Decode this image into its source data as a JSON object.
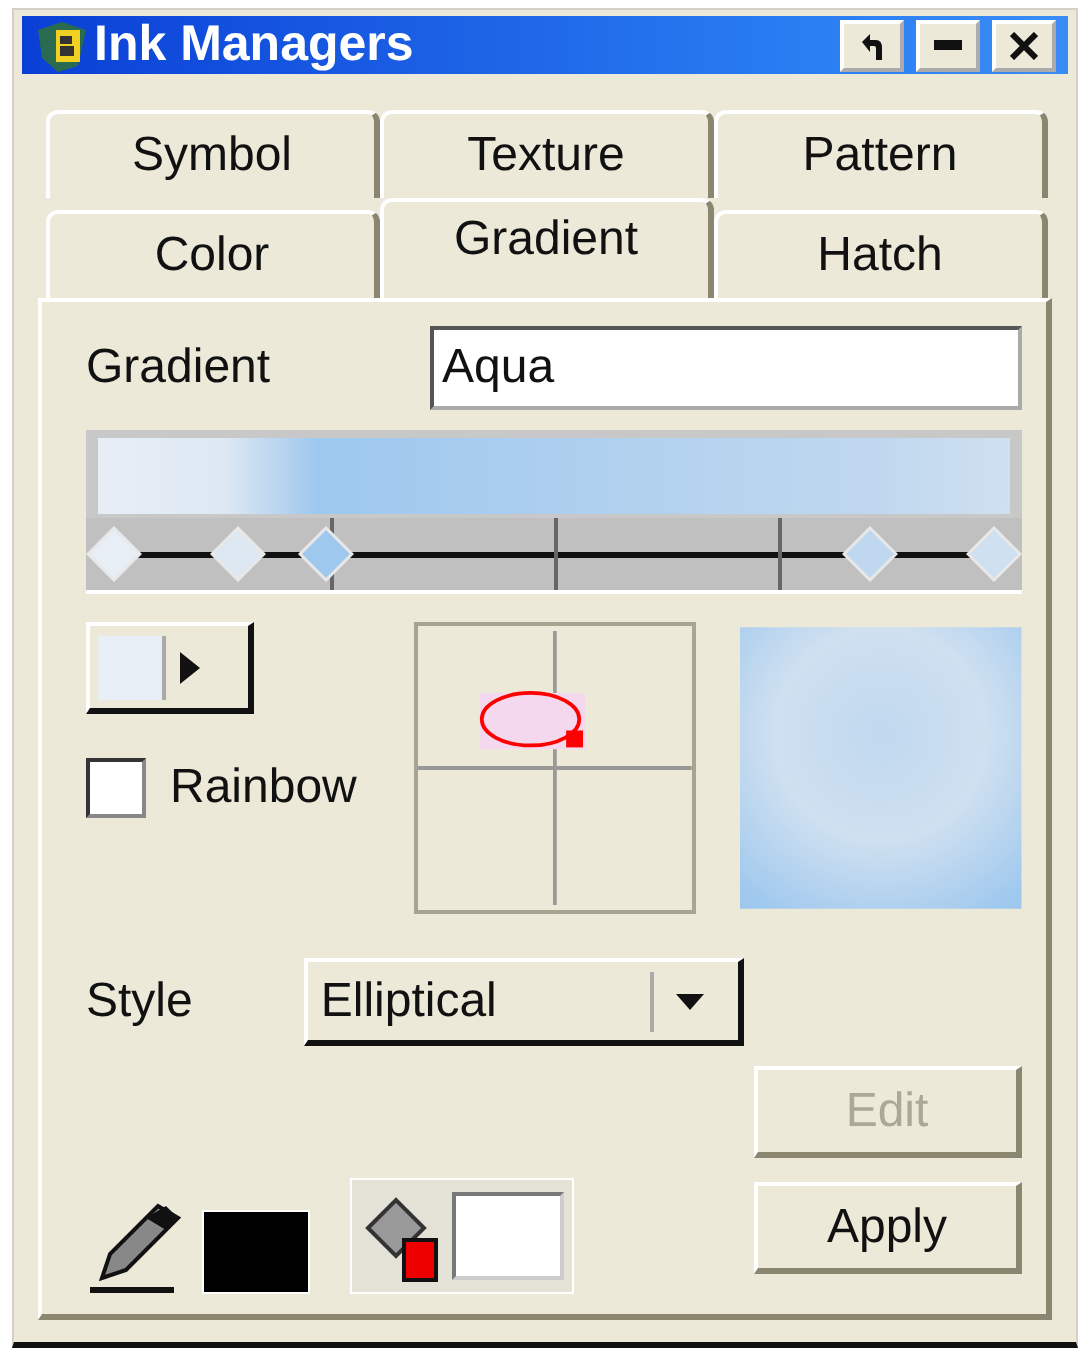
{
  "window": {
    "title": "Ink Managers"
  },
  "tab_rows": [
    {
      "tabs": [
        {
          "label": "Symbol",
          "selected": false
        },
        {
          "label": "Texture",
          "selected": false
        },
        {
          "label": "Pattern",
          "selected": false
        }
      ]
    },
    {
      "tabs": [
        {
          "label": "Color",
          "selected": false
        },
        {
          "label": "Gradient",
          "selected": true
        },
        {
          "label": "Hatch",
          "selected": false
        }
      ]
    }
  ],
  "gradient_name": {
    "label": "Gradient",
    "value": "Aqua"
  },
  "gradient_stops": [
    {
      "level": 0,
      "color": "#e8eef6"
    },
    {
      "level": 0.14,
      "color": "#dde8f3"
    },
    {
      "level": 0.24,
      "color": "#9ec8ee"
    },
    {
      "level": 0.86,
      "color": "#c0d8ef"
    },
    {
      "level": 1,
      "color": "#cfe0f0"
    }
  ],
  "rainbow": {
    "label": "Rainbow",
    "checked": false
  },
  "style": {
    "label": "Style",
    "value": "Elliptical"
  },
  "swatches": [
    {
      "kind": "line",
      "color": "#000000"
    },
    {
      "kind": "fill",
      "color": "#ffffff"
    }
  ],
  "buttons": [
    {
      "label": "Edit",
      "disabled": true
    },
    {
      "label": "Apply",
      "disabled": false
    }
  ]
}
